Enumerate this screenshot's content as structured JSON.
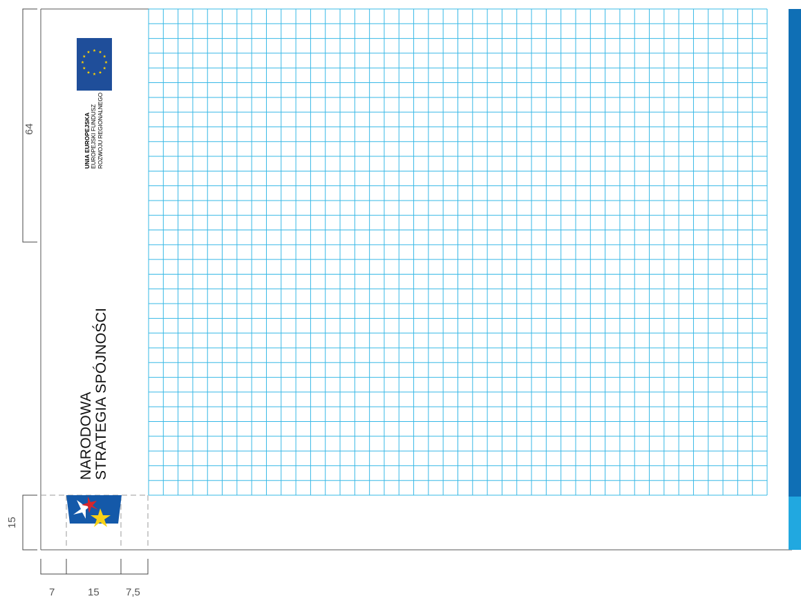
{
  "dimensions": {
    "logo_zone_height": "64",
    "bottom_zone_height": "15",
    "left_margin": "7",
    "logo_width": "15",
    "right_margin": "7,5"
  },
  "eu_logo": {
    "line1": "UNIA EUROPEJSKA",
    "line2": "EUROPEJSKI FUNDUSZ",
    "line3": "ROZWOJU REGIONALNEGO",
    "flag_color": "#1f4e9a",
    "star_color": "#ffd200"
  },
  "nss_logo": {
    "line1": "NARODOWA",
    "line2": "STRATEGIA SPÓJNOŚCI",
    "colors": {
      "blue": "#1459a9",
      "red": "#d7262b",
      "yellow": "#f7d117",
      "white": "#ffffff"
    }
  },
  "grid": {
    "color": "#36b8e6",
    "columns": 42,
    "rows": 33
  },
  "colors": {
    "frame": "#555555",
    "stripe_dark": "#0f6fb5",
    "stripe_light": "#21a8e0"
  }
}
